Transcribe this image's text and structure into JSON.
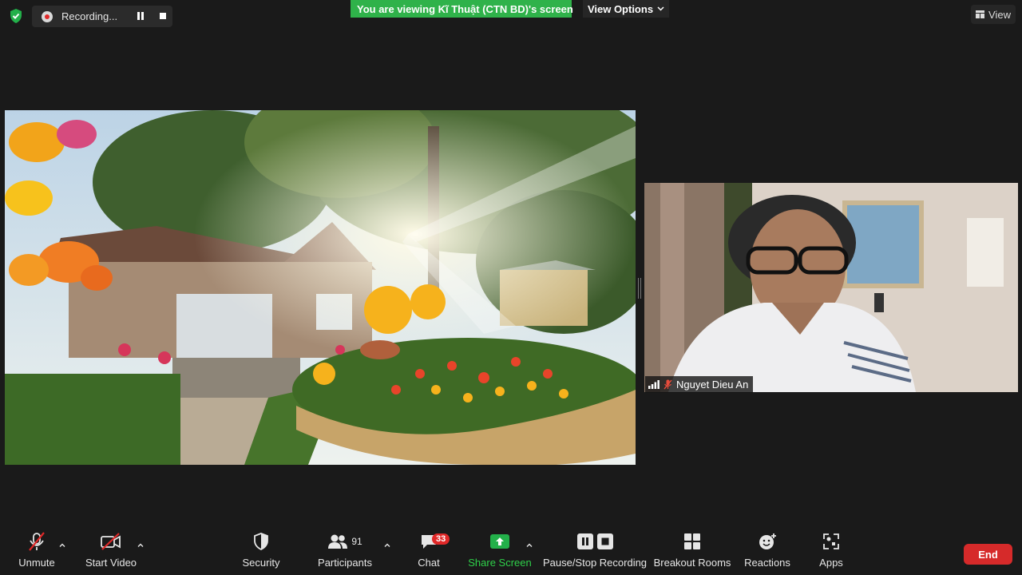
{
  "top_bar": {
    "recording_label": "Recording...",
    "viewing_banner": "You are viewing Kĩ Thuật (CTN BD)'s screen",
    "view_options_label": "View Options",
    "view_label": "View"
  },
  "participant": {
    "name": "Nguyet Dieu An",
    "mic_muted": true
  },
  "toolbar": {
    "unmute_label": "Unmute",
    "start_video_label": "Start Video",
    "security_label": "Security",
    "participants_label": "Participants",
    "participants_count": "91",
    "chat_label": "Chat",
    "chat_badge": "33",
    "share_screen_label": "Share Screen",
    "recording_label": "Pause/Stop Recording",
    "breakout_label": "Breakout Rooms",
    "reactions_label": "Reactions",
    "apps_label": "Apps",
    "end_label": "End"
  },
  "colors": {
    "share_green": "#2fb24a",
    "end_red": "#d62a2a",
    "badge_red": "#e02828",
    "background": "#1a1a1a"
  }
}
